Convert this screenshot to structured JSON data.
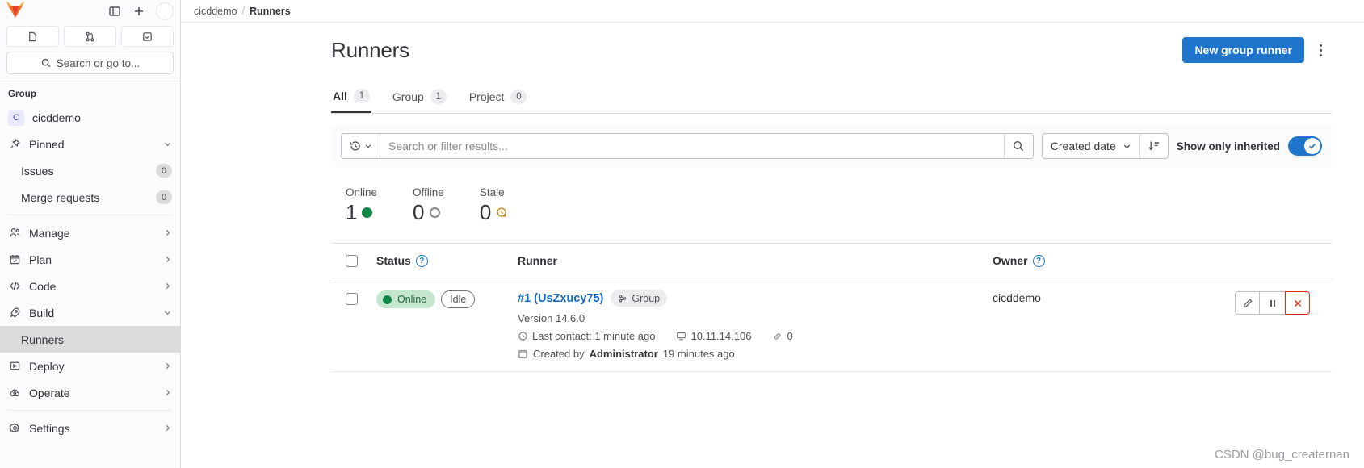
{
  "sidebar": {
    "top_icons": [
      "panel-toggle-icon",
      "plus-icon",
      "avatar"
    ],
    "tabs": [
      "issues-list-icon",
      "merge-request-icon",
      "todo-check-icon"
    ],
    "search_placeholder": "Search or go to...",
    "section_label": "Group",
    "group": {
      "initial": "C",
      "name": "cicddemo"
    },
    "pinned": {
      "label": "Pinned",
      "icon": "pin-icon"
    },
    "pinned_items": [
      {
        "label": "Issues",
        "count": "0"
      },
      {
        "label": "Merge requests",
        "count": "0"
      }
    ],
    "nav": [
      {
        "label": "Manage",
        "icon": "users-icon",
        "chevron": "right"
      },
      {
        "label": "Plan",
        "icon": "calendar-icon",
        "chevron": "right"
      },
      {
        "label": "Code",
        "icon": "code-icon",
        "chevron": "right"
      },
      {
        "label": "Build",
        "icon": "rocket-icon",
        "chevron": "down"
      }
    ],
    "build_children": [
      {
        "label": "Runners",
        "active": true
      }
    ],
    "nav2": [
      {
        "label": "Deploy",
        "icon": "deploy-icon",
        "chevron": "right"
      },
      {
        "label": "Operate",
        "icon": "cloud-gear-icon",
        "chevron": "right"
      }
    ],
    "nav3": [
      {
        "label": "Settings",
        "icon": "gear-icon",
        "chevron": "right"
      }
    ]
  },
  "breadcrumb": {
    "parent": "cicddemo",
    "separator": "/",
    "current": "Runners"
  },
  "header": {
    "title": "Runners",
    "new_runner_button": "New group runner",
    "kebab": "more-actions-icon"
  },
  "tabs": [
    {
      "label": "All",
      "count": "1",
      "active": true
    },
    {
      "label": "Group",
      "count": "1",
      "active": false
    },
    {
      "label": "Project",
      "count": "0",
      "active": false
    }
  ],
  "filter": {
    "history_icon": "history-icon",
    "search_placeholder": "Search or filter results...",
    "search_value": "",
    "search_icon": "search-icon",
    "sort_by": "Created date",
    "sort_direction_icon": "sort-descending-icon",
    "toggle_label": "Show only inherited",
    "toggle_on": true,
    "toggle_color": "#1f75cb"
  },
  "stats": [
    {
      "label": "Online",
      "value": "1",
      "indicator": "filled-green-dot",
      "color": "#108548"
    },
    {
      "label": "Offline",
      "value": "0",
      "indicator": "hollow-grey-dot",
      "color": "#89888d"
    },
    {
      "label": "Stale",
      "value": "0",
      "indicator": "stale-clock-icon",
      "color": "#c17d10"
    }
  ],
  "table": {
    "headers": {
      "status": "Status",
      "status_help": "?",
      "runner": "Runner",
      "owner": "Owner",
      "owner_help": "?"
    },
    "rows": [
      {
        "status_badge": "Online",
        "state_badge": "Idle",
        "name": "#1 (UsZxucy75)",
        "scope_badge": "Group",
        "version": "Version 14.6.0",
        "last_contact": "Last contact: 1 minute ago",
        "ip_address": "10.11.14.106",
        "tags_count": "0",
        "created_prefix": "Created by",
        "created_by": "Administrator",
        "created_suffix": "19 minutes ago",
        "owner": "cicddemo",
        "actions": [
          "edit-icon",
          "pause-icon",
          "delete-icon"
        ]
      }
    ]
  },
  "watermark": "CSDN @bug_creaternan"
}
